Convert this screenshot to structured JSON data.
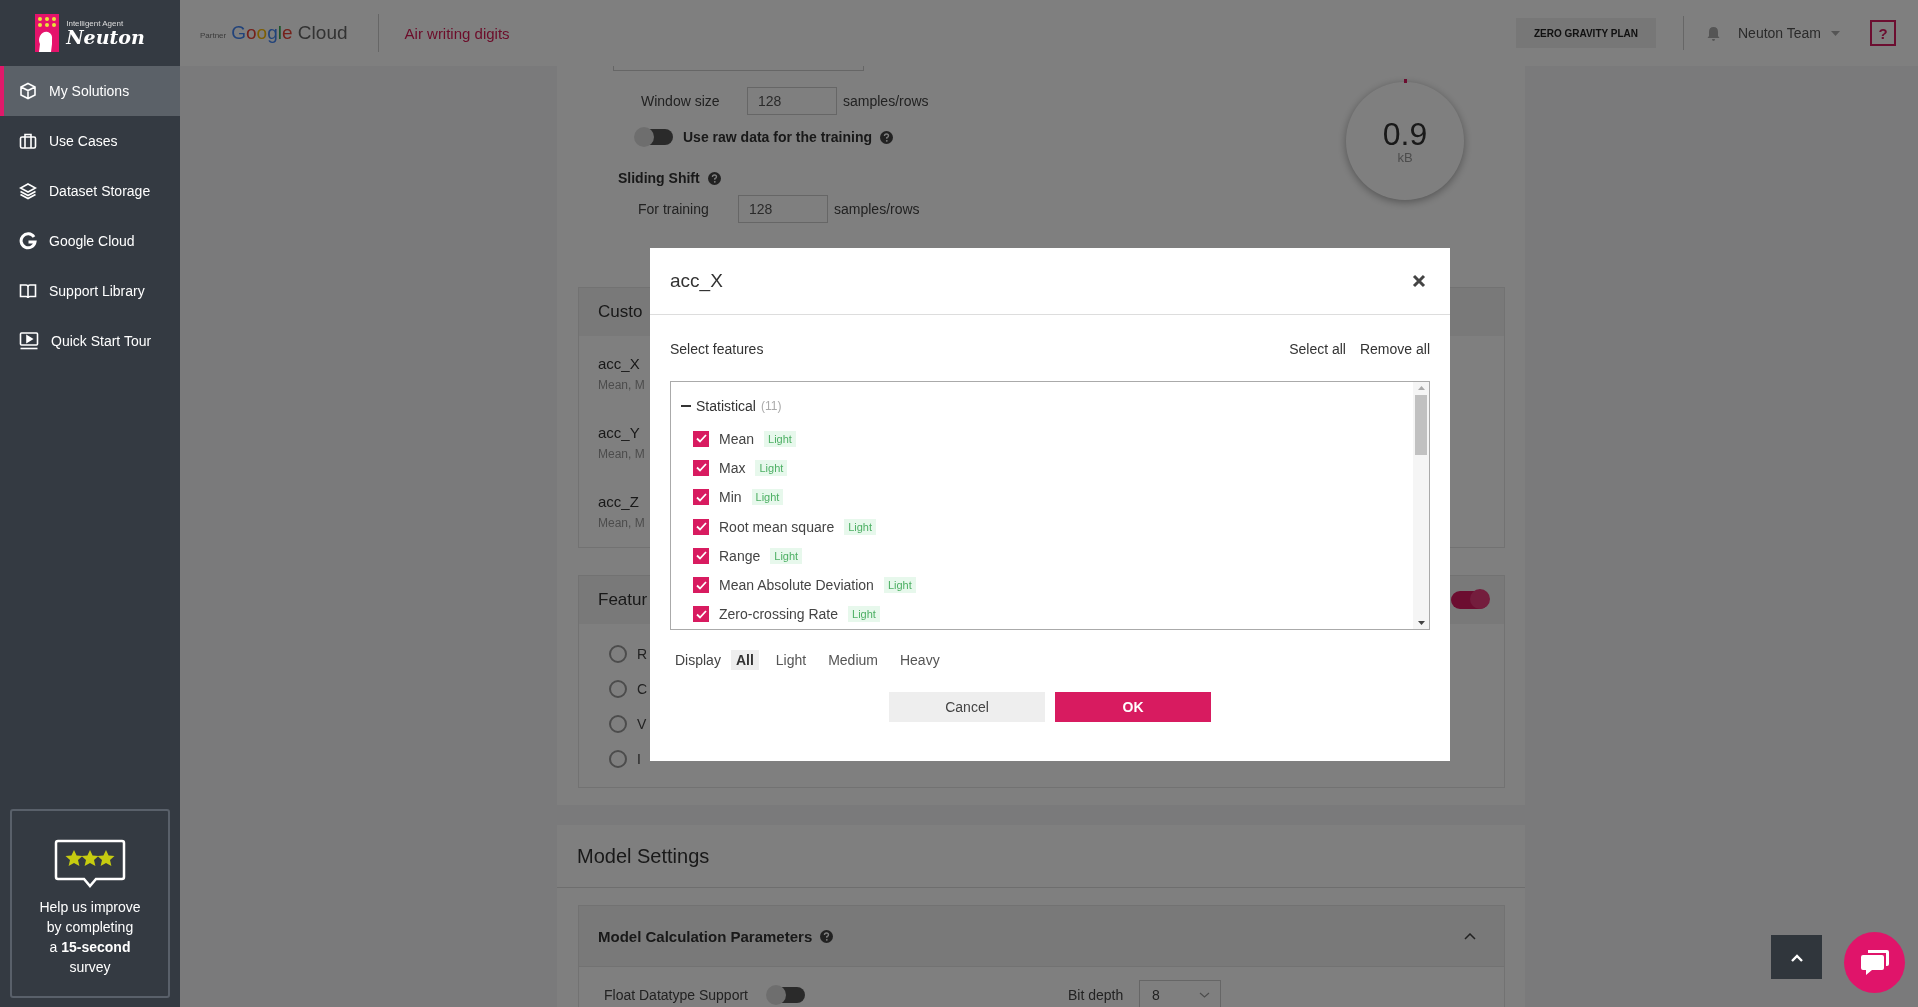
{
  "sidebar": {
    "logo": {
      "tagline": "Intelligent Agent",
      "name": "Neuton"
    },
    "items": [
      {
        "label": "My Solutions",
        "selected": true
      },
      {
        "label": "Use Cases",
        "selected": false
      },
      {
        "label": "Dataset Storage",
        "selected": false
      },
      {
        "label": "Google Cloud",
        "selected": false
      },
      {
        "label": "Support Library",
        "selected": false
      },
      {
        "label": "Quick Start Tour",
        "selected": false
      }
    ],
    "survey": {
      "lines": [
        "Help us improve",
        "by completing",
        "a **15-second**",
        "survey"
      ]
    }
  },
  "header": {
    "partner_label": "Partner",
    "partner_name": "Google Cloud",
    "project": "Air writing digits",
    "plan_button": "ZERO GRAVITY PLAN",
    "user": "Neuton Team",
    "help": "?"
  },
  "window_settings": {
    "window_size_label": "Window size",
    "window_size": "128",
    "unit": "samples/rows",
    "raw_data": {
      "label": "Use raw data for the training",
      "on": false
    },
    "sliding_shift": {
      "title": "Sliding Shift",
      "for_training_label": "For training",
      "for_training": "128",
      "unit": "samples/rows"
    }
  },
  "gauge": {
    "value": "0.9",
    "unit": "kB"
  },
  "custom_panel": {
    "title": "Custo",
    "signals": [
      {
        "name": "acc_X",
        "features": "Mean, M"
      },
      {
        "name": "acc_Y",
        "features": "Mean, M"
      },
      {
        "name": "acc_Z",
        "features": "Mean, M"
      }
    ]
  },
  "feature_panel": {
    "title": "Featur",
    "on": true,
    "options": [
      {
        "label": "R",
        "selected": false
      },
      {
        "label": "C",
        "selected": false
      },
      {
        "label": "V",
        "selected": false
      },
      {
        "label": "I",
        "selected": false
      }
    ]
  },
  "model_settings": {
    "title": "Model Settings",
    "params": {
      "title": "Model Calculation Parameters",
      "expanded": true,
      "float_support": {
        "label": "Float Datatype Support",
        "on": false
      },
      "bit_depth": {
        "label": "Bit depth",
        "value": "8"
      }
    }
  },
  "modal": {
    "title": "acc_X",
    "select_label": "Select features",
    "actions": [
      "Select all",
      "Remove all"
    ],
    "groups": [
      {
        "name": "Statistical",
        "count": "(11)",
        "expanded": true,
        "features": [
          {
            "label": "Mean",
            "checked": true,
            "tag": "Light"
          },
          {
            "label": "Max",
            "checked": true,
            "tag": "Light"
          },
          {
            "label": "Min",
            "checked": true,
            "tag": "Light"
          },
          {
            "label": "Root mean square",
            "checked": true,
            "tag": "Light"
          },
          {
            "label": "Range",
            "checked": true,
            "tag": "Light"
          },
          {
            "label": "Mean Absolute Deviation",
            "checked": true,
            "tag": "Light"
          },
          {
            "label": "Zero-crossing Rate",
            "checked": true,
            "tag": "Light"
          }
        ]
      }
    ],
    "display": {
      "label": "Display",
      "options": [
        {
          "label": "All",
          "selected": true
        },
        {
          "label": "Light",
          "selected": false
        },
        {
          "label": "Medium",
          "selected": false
        },
        {
          "label": "Heavy",
          "selected": false
        }
      ]
    },
    "buttons": {
      "cancel": "Cancel",
      "ok": "OK"
    }
  }
}
